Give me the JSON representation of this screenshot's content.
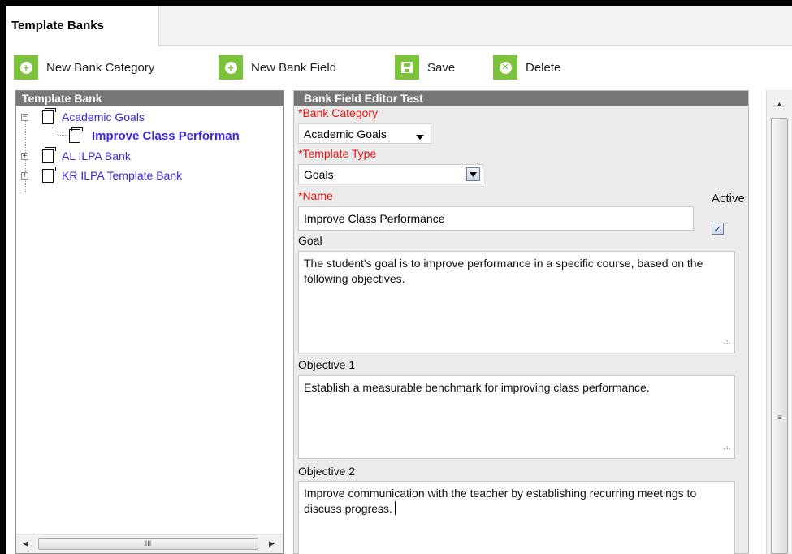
{
  "tabs": [
    {
      "label": "Template Banks",
      "active": true
    }
  ],
  "toolbar": {
    "new_bank_category": "New Bank Category",
    "new_bank_field": "New Bank Field",
    "save": "Save",
    "delete": "Delete"
  },
  "left_panel": {
    "title": "Template Bank",
    "tree": [
      {
        "label": "Academic Goals",
        "expanded": true,
        "toggle": "−",
        "children": [
          {
            "label": "Improve Class Performan",
            "selected": true
          }
        ]
      },
      {
        "label": "AL ILPA Bank",
        "expanded": false,
        "toggle": "+"
      },
      {
        "label": "KR ILPA Template Bank",
        "expanded": false,
        "toggle": "+"
      }
    ],
    "hscroll_grip": "III"
  },
  "editor": {
    "title": "Bank Field Editor Test",
    "bank_category": {
      "label": "*Bank Category",
      "value": "Academic Goals"
    },
    "template_type": {
      "label": "*Template Type",
      "value": "Goals"
    },
    "name": {
      "label": "*Name",
      "value": "Improve Class Performance"
    },
    "active": {
      "label": "Active",
      "checked": true,
      "mark": "✓"
    },
    "goal": {
      "label": "Goal",
      "value": "The student's goal is to improve performance in a specific course, based on the following objectives."
    },
    "objective1": {
      "label": "Objective 1",
      "value": "Establish a measurable benchmark for improving class performance."
    },
    "objective2": {
      "label": "Objective 2",
      "value": "Improve communication with the teacher by establishing recurring meetings to discuss progress."
    }
  },
  "colors": {
    "accent_green": "#7cc23c",
    "header_gray": "#777777",
    "link_blue": "#3a27dc",
    "required_red": "#e31515"
  },
  "icons": [
    "plus-circle-icon",
    "plus-circle-icon",
    "save-disk-icon",
    "x-circle-icon"
  ]
}
